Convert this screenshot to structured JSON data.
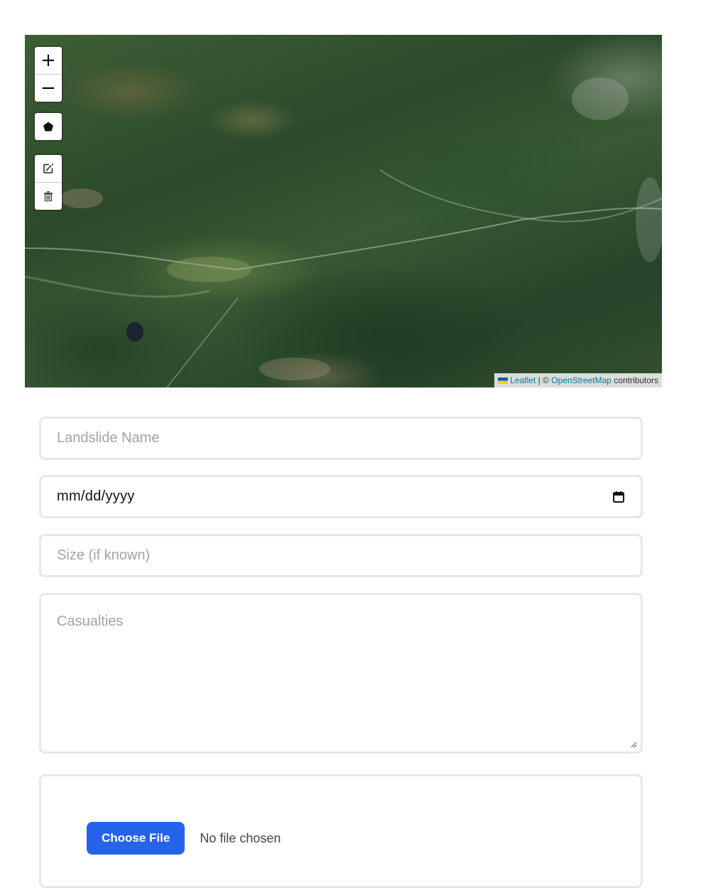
{
  "map": {
    "controls": {
      "zoom_in": "+",
      "zoom_out": "−"
    },
    "attribution": {
      "leaflet": "Leaflet",
      "separator": " | © ",
      "osm": "OpenStreetMap",
      "suffix": " contributors"
    }
  },
  "form": {
    "name_placeholder": "Landslide Name",
    "date_value": "mm/dd/yyyy",
    "size_placeholder": "Size (if known)",
    "casualties_placeholder": "Casualties",
    "file": {
      "button_label": "Choose File",
      "status": "No file chosen"
    }
  },
  "colors": {
    "accent": "#2563eb",
    "border": "#e5e7eb",
    "placeholder": "#9ca3af",
    "link": "#0078a8"
  }
}
